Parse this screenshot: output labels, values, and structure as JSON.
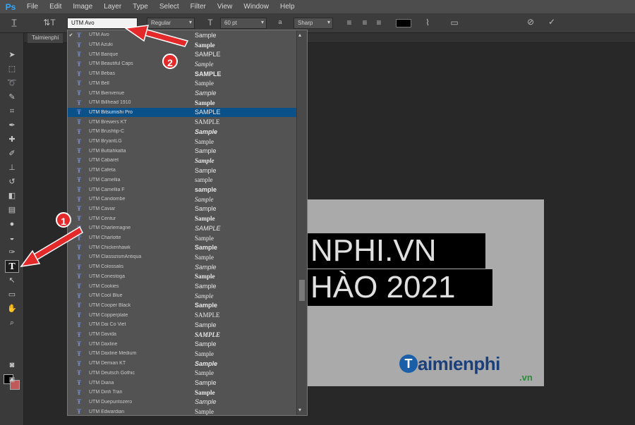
{
  "app": {
    "logo": "Ps"
  },
  "menu": [
    "File",
    "Edit",
    "Image",
    "Layer",
    "Type",
    "Select",
    "Filter",
    "View",
    "Window",
    "Help"
  ],
  "options": {
    "font_family": "UTM Avo",
    "font_style": "Regular",
    "font_size": "60 pt",
    "aa_prefix": "a",
    "anti_alias": "Sharp"
  },
  "document_tab": "Taimienphi",
  "canvas": {
    "headline_1": "NPHI.VN",
    "headline_2": "HÀO 2021",
    "logo_letter": "T",
    "logo_text": "aimienphi",
    "logo_domain": ".vn"
  },
  "annotations": {
    "badge_1": "1",
    "badge_2": "2"
  },
  "colors": {
    "accent": "#31a8ff",
    "selection": "#0a5089",
    "badge": "#e32929",
    "foreground": "#000000",
    "background": "#c05a5a"
  },
  "fonts": [
    {
      "name": "UTM Avo",
      "sample": "Sample",
      "checked": true
    },
    {
      "name": "UTM Azuki",
      "sample": "Sample"
    },
    {
      "name": "UTM Banque",
      "sample": "SAMPLE"
    },
    {
      "name": "UTM Beautiful Caps",
      "sample": "Sample"
    },
    {
      "name": "UTM Bebas",
      "sample": "SAMPLE"
    },
    {
      "name": "UTM Bell",
      "sample": "Sample"
    },
    {
      "name": "UTM Bienvenue",
      "sample": "Sample"
    },
    {
      "name": "UTM Billhead 1910",
      "sample": "Sample"
    },
    {
      "name": "UTM Bitsumishi Pro",
      "sample": "SAMPLE",
      "selected": true
    },
    {
      "name": "UTM Brewers KT",
      "sample": "SAMPLE"
    },
    {
      "name": "UTM Brushtip-C",
      "sample": "Sample"
    },
    {
      "name": "UTM BryantLG",
      "sample": "Sample"
    },
    {
      "name": "UTM Buttahkatta",
      "sample": "Sample"
    },
    {
      "name": "UTM Cabaret",
      "sample": "Sample"
    },
    {
      "name": "UTM Cafeta",
      "sample": "Sample"
    },
    {
      "name": "UTM Camellia",
      "sample": "sample"
    },
    {
      "name": "UTM Camellia F",
      "sample": "sample"
    },
    {
      "name": "UTM Candombe",
      "sample": "Sample"
    },
    {
      "name": "UTM Caviar",
      "sample": "Sample"
    },
    {
      "name": "UTM Centur",
      "sample": "Sample"
    },
    {
      "name": "UTM Charlemagne",
      "sample": "SAMPLE"
    },
    {
      "name": "UTM Charlotte",
      "sample": "Sample"
    },
    {
      "name": "UTM Chickenhawk",
      "sample": "Sample"
    },
    {
      "name": "UTM ClassizismAntiqua",
      "sample": "Sample"
    },
    {
      "name": "UTM Colossalis",
      "sample": "Sample"
    },
    {
      "name": "UTM Conestoga",
      "sample": "Sample"
    },
    {
      "name": "UTM Cookies",
      "sample": "Sample"
    },
    {
      "name": "UTM Cool Blue",
      "sample": "Sample"
    },
    {
      "name": "UTM Cooper Black",
      "sample": "Sample"
    },
    {
      "name": "UTM Copperplate",
      "sample": "SAMPLE"
    },
    {
      "name": "UTM Dai Co Viet",
      "sample": "Sample"
    },
    {
      "name": "UTM Davida",
      "sample": "SAMPLE"
    },
    {
      "name": "UTM Daxline",
      "sample": "Sample"
    },
    {
      "name": "UTM Daxline Medium",
      "sample": "Sample"
    },
    {
      "name": "UTM Demian KT",
      "sample": "Sample"
    },
    {
      "name": "UTM Deutsch Gothic",
      "sample": "Sample"
    },
    {
      "name": "UTM Diana",
      "sample": "Sample"
    },
    {
      "name": "UTM Dinh Tran",
      "sample": "Sample"
    },
    {
      "name": "UTM Duepuntozero",
      "sample": "Sample"
    },
    {
      "name": "UTM Edwardian",
      "sample": "Sample"
    }
  ]
}
